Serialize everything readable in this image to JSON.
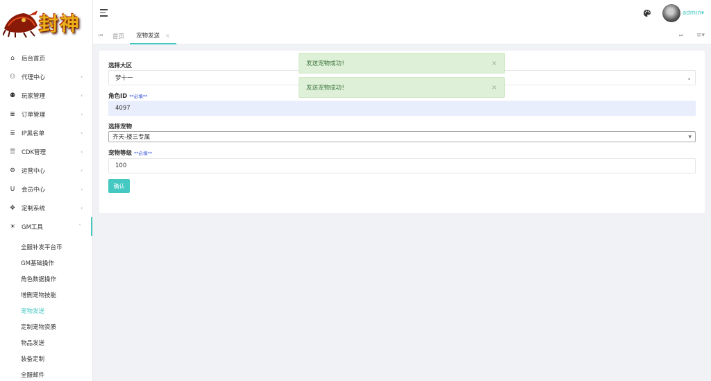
{
  "brand": {
    "logo_text": "封神"
  },
  "header": {
    "user": "admin▾"
  },
  "sidebar": {
    "items": [
      {
        "label": "后台首页",
        "icon": "home-icon",
        "glyph": "⌂",
        "arrow": ""
      },
      {
        "label": "代理中心",
        "icon": "users-icon",
        "glyph": "⚇",
        "arrow": "‹"
      },
      {
        "label": "玩家管理",
        "icon": "group-icon",
        "glyph": "⚉",
        "arrow": "‹"
      },
      {
        "label": "订单管理",
        "icon": "database-icon",
        "glyph": "≣",
        "arrow": "‹"
      },
      {
        "label": "IP黑名单",
        "icon": "database-icon",
        "glyph": "≣",
        "arrow": "‹"
      },
      {
        "label": "CDK管理",
        "icon": "list-icon",
        "glyph": "☰",
        "arrow": "‹"
      },
      {
        "label": "运营中心",
        "icon": "gear-icon",
        "glyph": "⚙",
        "arrow": "‹"
      },
      {
        "label": "会员中心",
        "icon": "magnet-icon",
        "glyph": "U",
        "arrow": "‹"
      },
      {
        "label": "定制系统",
        "icon": "gamepad-icon",
        "glyph": "✥",
        "arrow": "‹"
      },
      {
        "label": "GM工具",
        "icon": "lightbulb-icon",
        "glyph": "☀",
        "arrow": "ˇ"
      }
    ],
    "gm_sub": [
      "全服补发平台币",
      "GM基础操作",
      "角色数据操作",
      "增删宠物技能",
      "宠物发送",
      "定制宠物资质",
      "物品发送",
      "装备定制",
      "全服邮件"
    ],
    "active_sub_index": 4
  },
  "tabs": {
    "home": "首页",
    "current": "宠物发送",
    "close": "×"
  },
  "form": {
    "region_label": "选择大区",
    "region_value": "梦十一",
    "role_label": "角色ID",
    "role_required": "**必填**",
    "role_value": "4097",
    "pet_label": "选择宠物",
    "pet_value": "齐天-楼三专属",
    "level_label": "宠物等级",
    "level_required": "**必填**",
    "level_value": "100",
    "confirm": "确认"
  },
  "toasts": [
    {
      "text": "发送宠物成功！",
      "close": "×"
    },
    {
      "text": "发送宠物成功！",
      "close": "×"
    }
  ],
  "colors": {
    "accent": "#45c8c2",
    "toast_bg": "#dff0d8",
    "toast_text": "#3c763d"
  }
}
